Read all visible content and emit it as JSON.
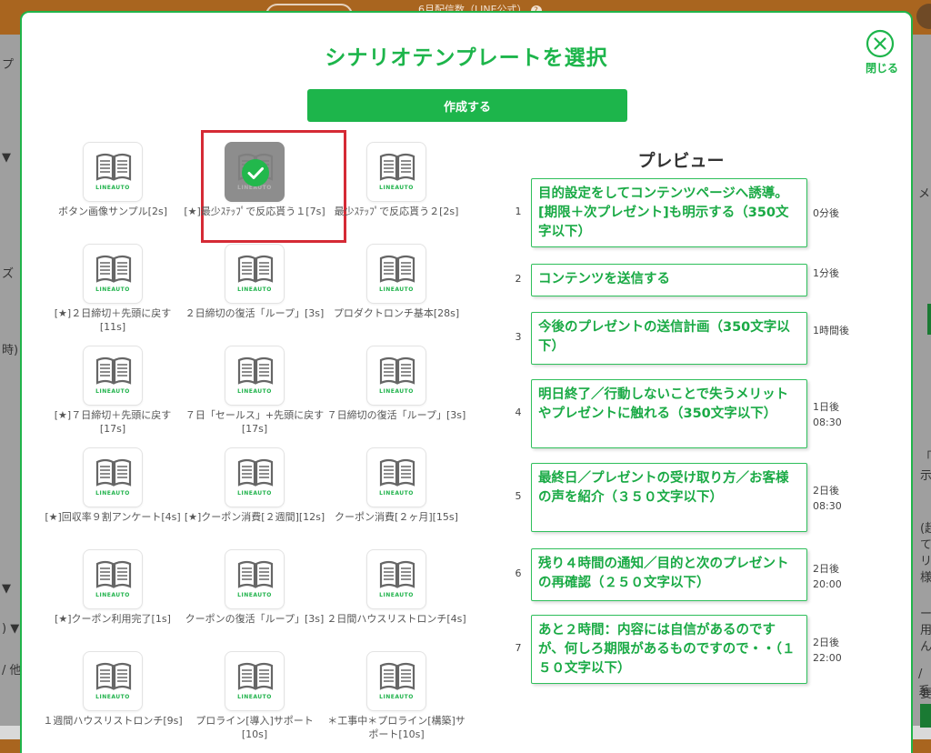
{
  "background": {
    "header_text": "6月配信数（LINE公式）",
    "help_icon": "question-circle-icon",
    "left_marks": [
      "プ",
      "▼",
      "ズ",
      "時)",
      "▼",
      ") ▼",
      "/ 他"
    ],
    "right_marks": [
      "メ",
      "「あ",
      "示",
      "(超",
      "て",
      "リ",
      "様",
      "ー",
      "用",
      "ん",
      "/ 系",
      "要"
    ]
  },
  "modal": {
    "title": "シナリオテンプレートを選択",
    "close_label": "閉じる",
    "close_icon": "close-circle-icon",
    "create_label": "作成する"
  },
  "templates": [
    {
      "label": "ボタン画像サンプル[2s]",
      "icon": "book-icon",
      "brand": "LINEAUTO",
      "selected": false
    },
    {
      "label": "[★]最少ｽﾃｯﾌﾟで反応貰う１[7s]",
      "icon": "book-icon",
      "brand": "LINEAUTO",
      "selected": true
    },
    {
      "label": "最少ｽﾃｯﾌﾟで反応貰う２[2s]",
      "icon": "book-icon",
      "brand": "LINEAUTO",
      "selected": false
    },
    {
      "label": "[★]２日締切＋先頭に戻す[11s]",
      "icon": "book-icon",
      "brand": "LINEAUTO",
      "selected": false
    },
    {
      "label": "２日締切の復活「ループ」[3s]",
      "icon": "book-icon",
      "brand": "LINEAUTO",
      "selected": false
    },
    {
      "label": "プロダクトロンチ基本[28s]",
      "icon": "book-icon",
      "brand": "LINEAUTO",
      "selected": false
    },
    {
      "label": "[★]７日締切＋先頭に戻す[17s]",
      "icon": "book-icon",
      "brand": "LINEAUTO",
      "selected": false
    },
    {
      "label": "７日「セールス」+先頭に戻す[17s]",
      "icon": "book-icon",
      "brand": "LINEAUTO",
      "selected": false
    },
    {
      "label": "７日締切の復活「ループ」[3s]",
      "icon": "book-icon",
      "brand": "LINEAUTO",
      "selected": false
    },
    {
      "label": "[★]回収率９割アンケート[4s]",
      "icon": "book-icon",
      "brand": "LINEAUTO",
      "selected": false
    },
    {
      "label": "[★]クーポン消費[２週間][12s]",
      "icon": "book-icon",
      "brand": "LINEAUTO",
      "selected": false
    },
    {
      "label": "クーポン消費[２ヶ月][15s]",
      "icon": "book-icon",
      "brand": "LINEAUTO",
      "selected": false
    },
    {
      "label": "[★]クーポン利用完了[1s]",
      "icon": "book-icon",
      "brand": "LINEAUTO",
      "selected": false
    },
    {
      "label": "クーポンの復活「ループ」[3s]",
      "icon": "book-icon",
      "brand": "LINEAUTO",
      "selected": false
    },
    {
      "label": "２日間ハウスリストロンチ[4s]",
      "icon": "book-icon",
      "brand": "LINEAUTO",
      "selected": false
    },
    {
      "label": "１週間ハウスリストロンチ[9s]",
      "icon": "book-icon",
      "brand": "LINEAUTO",
      "selected": false
    },
    {
      "label": "プロライン[導入]サポート[10s]",
      "icon": "book-icon",
      "brand": "LINEAUTO",
      "selected": false
    },
    {
      "label": "＊工事中＊プロライン[構築]サポート[10s]",
      "icon": "book-icon",
      "brand": "LINEAUTO",
      "selected": false
    }
  ],
  "preview": {
    "title": "プレビュー",
    "steps": [
      {
        "num": "1",
        "text": "目的設定をしてコンテンツページへ誘導。[期限＋次プレゼント]も明示する（350文字以下）",
        "time": "0分後"
      },
      {
        "num": "2",
        "text": "コンテンツを送信する",
        "time": "1分後"
      },
      {
        "num": "3",
        "text": "今後のプレゼントの送信計画（350文字以下）",
        "time": "1時間後"
      },
      {
        "num": "4",
        "text": "明日終了／行動しないことで失うメリットやプレゼントに触れる（350文字以下）",
        "time": "1日後 08:30"
      },
      {
        "num": "5",
        "text": "最終日／プレゼントの受け取り方／お客様の声を紹介（３５０文字以下）",
        "time": "2日後 08:30"
      },
      {
        "num": "6",
        "text": "残り４時間の通知／目的と次のプレゼントの再確認（２５０文字以下）",
        "time": "2日後 20:00"
      },
      {
        "num": "7",
        "text": "あと２時間：内容には自信があるのですが、何しろ期限があるものですので・・（１５０文字以下）",
        "time": "2日後 22:00"
      }
    ]
  },
  "colors": {
    "accent": "#1db54b",
    "selection_frame": "#d52a35",
    "header_bg": "#a9651f"
  }
}
